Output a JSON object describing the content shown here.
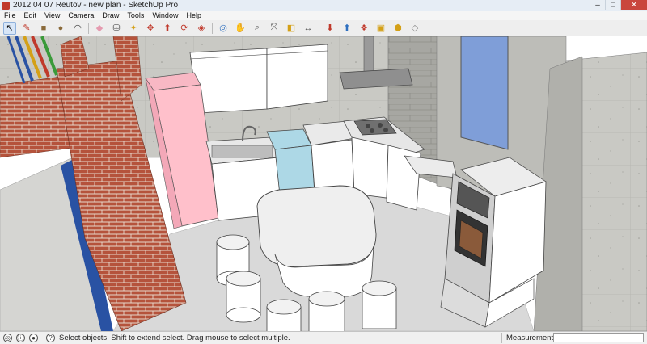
{
  "window": {
    "title": "2012 04 07 Reutov - new plan - SketchUp Pro",
    "controls": {
      "minimize": "–",
      "maximize": "□",
      "close": "✕"
    }
  },
  "menubar": {
    "items": [
      "File",
      "Edit",
      "View",
      "Camera",
      "Draw",
      "Tools",
      "Window",
      "Help"
    ]
  },
  "toolbar": {
    "tools": [
      {
        "icon": "select-arrow-icon",
        "glyph": "↖",
        "color": "#111111"
      },
      {
        "icon": "pencil-line-icon",
        "glyph": "✎",
        "color": "#c0392b"
      },
      {
        "icon": "rectangle-icon",
        "glyph": "■",
        "color": "#8a6a3a"
      },
      {
        "icon": "circle-icon",
        "glyph": "●",
        "color": "#8a6a3a"
      },
      {
        "icon": "arc-icon",
        "glyph": "◠",
        "color": "#333333"
      },
      {
        "icon": "eraser-icon",
        "glyph": "◆",
        "color": "#e59bb0"
      },
      {
        "icon": "paint-bucket-icon",
        "glyph": "⛁",
        "color": "#555555"
      },
      {
        "icon": "tape-measure-icon",
        "glyph": "✦",
        "color": "#d4a017"
      },
      {
        "icon": "move-icon",
        "glyph": "✥",
        "color": "#c0392b"
      },
      {
        "icon": "push-pull-icon",
        "glyph": "⬆",
        "color": "#c0392b"
      },
      {
        "icon": "rotate-icon",
        "glyph": "⟳",
        "color": "#c0392b"
      },
      {
        "icon": "offset-icon",
        "glyph": "◈",
        "color": "#c0392b"
      },
      {
        "icon": "orbit-icon",
        "glyph": "◎",
        "color": "#2e6fbf"
      },
      {
        "icon": "pan-icon",
        "glyph": "✋",
        "color": "#555555"
      },
      {
        "icon": "zoom-icon",
        "glyph": "⌕",
        "color": "#555555"
      },
      {
        "icon": "zoom-extents-icon",
        "glyph": "⤧",
        "color": "#555555"
      },
      {
        "icon": "section-plane-icon",
        "glyph": "◧",
        "color": "#d4a017"
      },
      {
        "icon": "dimension-icon",
        "glyph": "↔",
        "color": "#555555"
      },
      {
        "icon": "get-models-icon",
        "glyph": "⬇",
        "color": "#c0392b"
      },
      {
        "icon": "share-model-icon",
        "glyph": "⬆",
        "color": "#2e6fbf"
      },
      {
        "icon": "components-icon",
        "glyph": "❖",
        "color": "#c0392b"
      },
      {
        "icon": "materials-icon",
        "glyph": "▣",
        "color": "#d4a017"
      },
      {
        "icon": "extension-warehouse-icon",
        "glyph": "⬢",
        "color": "#d4a017"
      },
      {
        "icon": "layout-icon",
        "glyph": "◇",
        "color": "#888888"
      }
    ]
  },
  "statusbar": {
    "hint": "Select objects. Shift to extend select. Drag mouse to select multiple.",
    "measurements_label": "Measurements",
    "measurements_value": ""
  },
  "colors": {
    "fridge": "#ffc0cb",
    "dishwasher": "#add8e6",
    "window_glass": "#7f9ed8",
    "brick": "#b5533c",
    "floor": "#d9d9d9",
    "cabinet": "#ffffff"
  }
}
